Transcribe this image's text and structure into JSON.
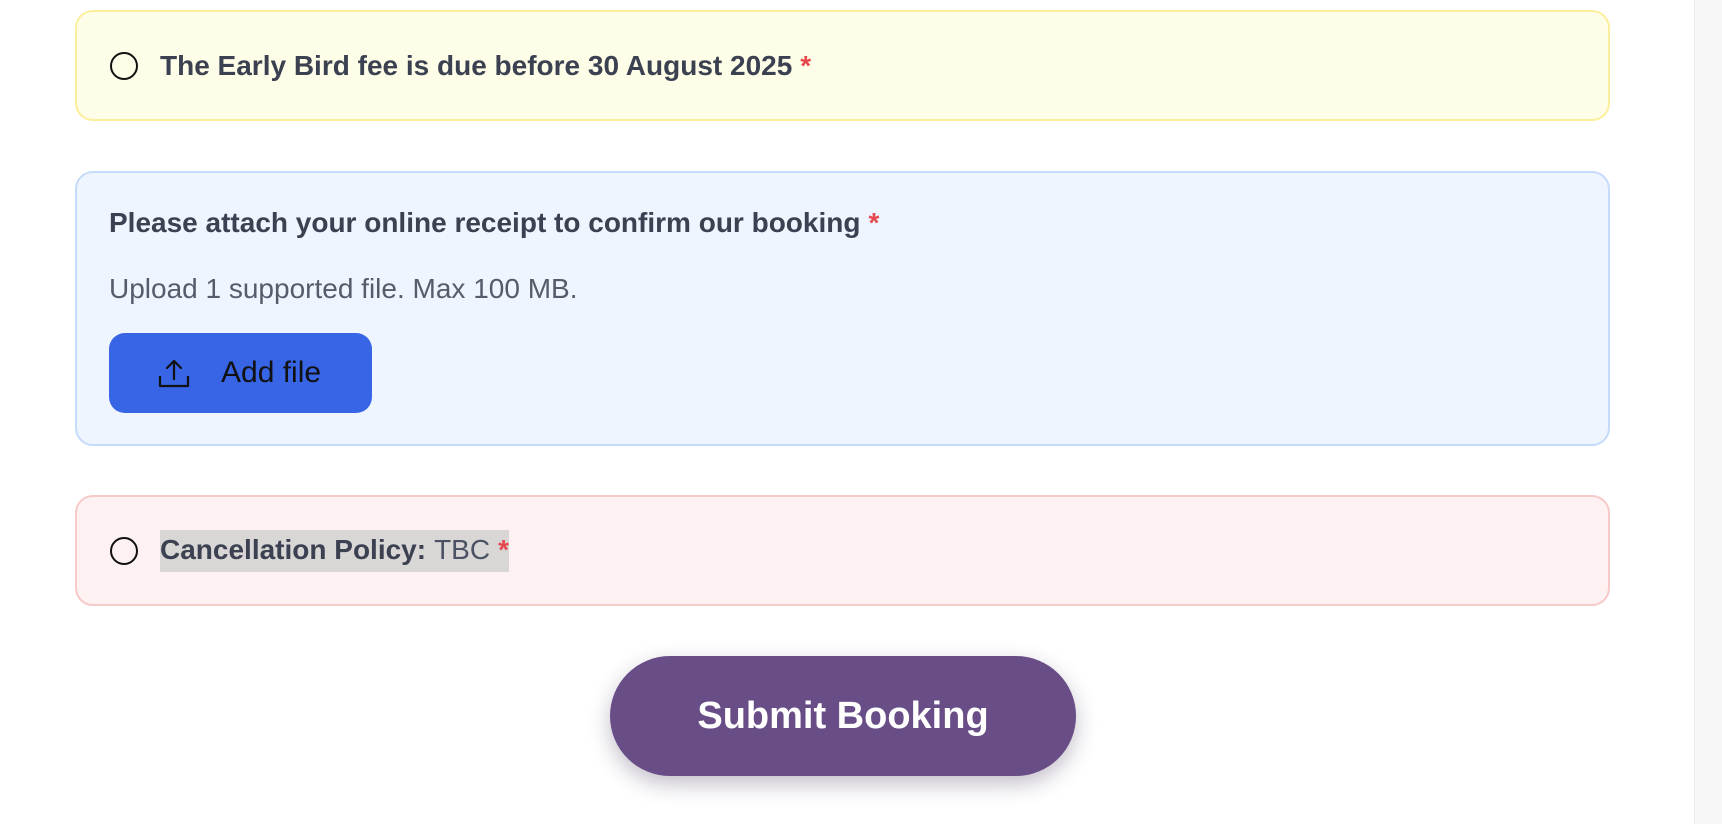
{
  "early_bird": {
    "label": "The Early Bird fee is due before 30 August 2025",
    "required_marker": "*"
  },
  "upload": {
    "title": "Please attach your online receipt to confirm our booking",
    "required_marker": "*",
    "hint": "Upload 1 supported file. Max 100 MB.",
    "button_label": "Add file",
    "button_icon": "upload-icon"
  },
  "cancellation": {
    "label_strong": "Cancellation Policy:",
    "value": "TBC",
    "required_marker": "*"
  },
  "submit": {
    "label": "Submit Booking"
  },
  "colors": {
    "early_bird_bg": "#fefde8",
    "upload_bg": "#eef5ff",
    "cancel_bg": "#fdf1f1",
    "add_file_button": "#3765e6",
    "submit_button": "#694d86",
    "required": "#e5484d"
  }
}
